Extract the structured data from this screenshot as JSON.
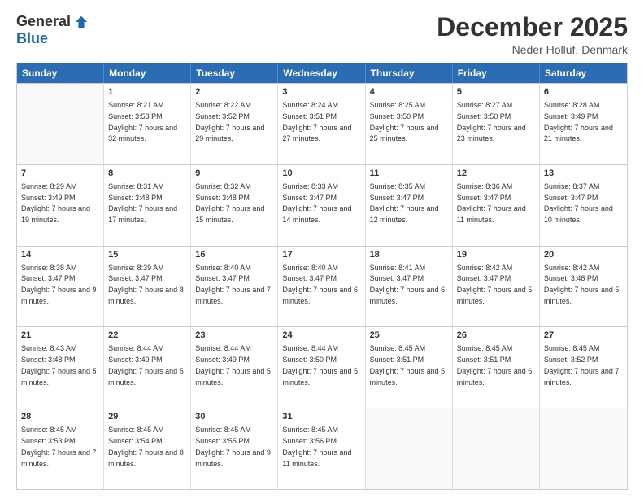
{
  "header": {
    "logo_general": "General",
    "logo_blue": "Blue",
    "month_title": "December 2025",
    "location": "Neder Holluf, Denmark"
  },
  "calendar": {
    "days": [
      "Sunday",
      "Monday",
      "Tuesday",
      "Wednesday",
      "Thursday",
      "Friday",
      "Saturday"
    ],
    "rows": [
      [
        {
          "day": "",
          "empty": true
        },
        {
          "day": "1",
          "sunrise": "8:21 AM",
          "sunset": "3:53 PM",
          "daylight": "7 hours and 32 minutes."
        },
        {
          "day": "2",
          "sunrise": "8:22 AM",
          "sunset": "3:52 PM",
          "daylight": "7 hours and 29 minutes."
        },
        {
          "day": "3",
          "sunrise": "8:24 AM",
          "sunset": "3:51 PM",
          "daylight": "7 hours and 27 minutes."
        },
        {
          "day": "4",
          "sunrise": "8:25 AM",
          "sunset": "3:50 PM",
          "daylight": "7 hours and 25 minutes."
        },
        {
          "day": "5",
          "sunrise": "8:27 AM",
          "sunset": "3:50 PM",
          "daylight": "7 hours and 23 minutes."
        },
        {
          "day": "6",
          "sunrise": "8:28 AM",
          "sunset": "3:49 PM",
          "daylight": "7 hours and 21 minutes."
        }
      ],
      [
        {
          "day": "7",
          "sunrise": "8:29 AM",
          "sunset": "3:49 PM",
          "daylight": "7 hours and 19 minutes."
        },
        {
          "day": "8",
          "sunrise": "8:31 AM",
          "sunset": "3:48 PM",
          "daylight": "7 hours and 17 minutes."
        },
        {
          "day": "9",
          "sunrise": "8:32 AM",
          "sunset": "3:48 PM",
          "daylight": "7 hours and 15 minutes."
        },
        {
          "day": "10",
          "sunrise": "8:33 AM",
          "sunset": "3:47 PM",
          "daylight": "7 hours and 14 minutes."
        },
        {
          "day": "11",
          "sunrise": "8:35 AM",
          "sunset": "3:47 PM",
          "daylight": "7 hours and 12 minutes."
        },
        {
          "day": "12",
          "sunrise": "8:36 AM",
          "sunset": "3:47 PM",
          "daylight": "7 hours and 11 minutes."
        },
        {
          "day": "13",
          "sunrise": "8:37 AM",
          "sunset": "3:47 PM",
          "daylight": "7 hours and 10 minutes."
        }
      ],
      [
        {
          "day": "14",
          "sunrise": "8:38 AM",
          "sunset": "3:47 PM",
          "daylight": "7 hours and 9 minutes."
        },
        {
          "day": "15",
          "sunrise": "8:39 AM",
          "sunset": "3:47 PM",
          "daylight": "7 hours and 8 minutes."
        },
        {
          "day": "16",
          "sunrise": "8:40 AM",
          "sunset": "3:47 PM",
          "daylight": "7 hours and 7 minutes."
        },
        {
          "day": "17",
          "sunrise": "8:40 AM",
          "sunset": "3:47 PM",
          "daylight": "7 hours and 6 minutes."
        },
        {
          "day": "18",
          "sunrise": "8:41 AM",
          "sunset": "3:47 PM",
          "daylight": "7 hours and 6 minutes."
        },
        {
          "day": "19",
          "sunrise": "8:42 AM",
          "sunset": "3:47 PM",
          "daylight": "7 hours and 5 minutes."
        },
        {
          "day": "20",
          "sunrise": "8:42 AM",
          "sunset": "3:48 PM",
          "daylight": "7 hours and 5 minutes."
        }
      ],
      [
        {
          "day": "21",
          "sunrise": "8:43 AM",
          "sunset": "3:48 PM",
          "daylight": "7 hours and 5 minutes."
        },
        {
          "day": "22",
          "sunrise": "8:44 AM",
          "sunset": "3:49 PM",
          "daylight": "7 hours and 5 minutes."
        },
        {
          "day": "23",
          "sunrise": "8:44 AM",
          "sunset": "3:49 PM",
          "daylight": "7 hours and 5 minutes."
        },
        {
          "day": "24",
          "sunrise": "8:44 AM",
          "sunset": "3:50 PM",
          "daylight": "7 hours and 5 minutes."
        },
        {
          "day": "25",
          "sunrise": "8:45 AM",
          "sunset": "3:51 PM",
          "daylight": "7 hours and 5 minutes."
        },
        {
          "day": "26",
          "sunrise": "8:45 AM",
          "sunset": "3:51 PM",
          "daylight": "7 hours and 6 minutes."
        },
        {
          "day": "27",
          "sunrise": "8:45 AM",
          "sunset": "3:52 PM",
          "daylight": "7 hours and 7 minutes."
        }
      ],
      [
        {
          "day": "28",
          "sunrise": "8:45 AM",
          "sunset": "3:53 PM",
          "daylight": "7 hours and 7 minutes."
        },
        {
          "day": "29",
          "sunrise": "8:45 AM",
          "sunset": "3:54 PM",
          "daylight": "7 hours and 8 minutes."
        },
        {
          "day": "30",
          "sunrise": "8:45 AM",
          "sunset": "3:55 PM",
          "daylight": "7 hours and 9 minutes."
        },
        {
          "day": "31",
          "sunrise": "8:45 AM",
          "sunset": "3:56 PM",
          "daylight": "7 hours and 11 minutes."
        },
        {
          "day": "",
          "empty": true
        },
        {
          "day": "",
          "empty": true
        },
        {
          "day": "",
          "empty": true
        }
      ]
    ]
  }
}
